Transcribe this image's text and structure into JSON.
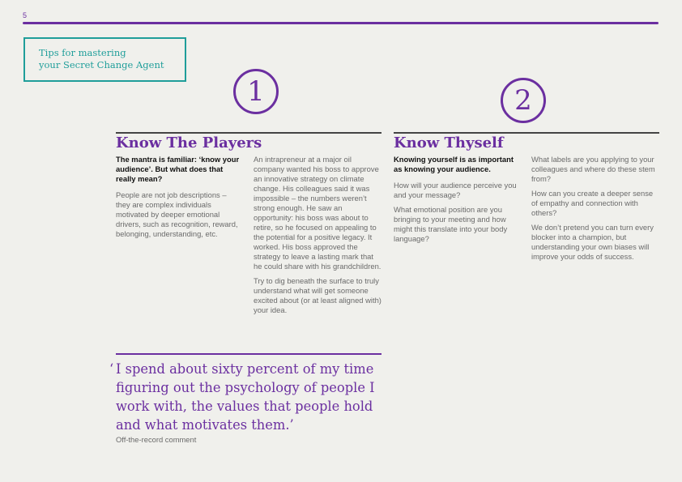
{
  "page_number": "5",
  "tips_box": {
    "line1": "Tips for mastering",
    "line2": "your Secret Change Agent"
  },
  "section1": {
    "number": "1",
    "title": "Know The Players",
    "lead": "The mantra is familiar: ‘know your audience’. But what does that really mean?",
    "col1_paragraphs": [
      "People are not job descriptions – they are complex individuals motivated by deeper emotional drivers, such as recognition, reward, belonging, understanding, etc."
    ],
    "col2_paragraphs": [
      "An intrapreneur at a major oil company wanted his boss to approve an innovative strategy on climate change. His colleagues said it was impossible – the numbers weren’t strong enough. He saw an opportunity: his boss was about to retire, so he focused on appealing to the potential for a positive legacy. It worked. His boss approved the strategy to leave a lasting mark that he could share with his grandchildren.",
      "Try to dig beneath the surface to truly understand what will get someone excited about (or at least aligned with) your idea."
    ]
  },
  "section2": {
    "number": "2",
    "title": "Know Thyself",
    "lead": "Knowing yourself is as important as knowing your audience.",
    "col3_paragraphs": [
      "How will your audience perceive you and your message?",
      "What emotional position are you bringing to your meeting and how might this translate into your body language?"
    ],
    "col4_paragraphs": [
      "What labels are you applying to your colleagues and where do these stem from?",
      "How can you create a deeper sense of empathy and connection with others?",
      "We don’t pretend you can turn every blocker into a champion, but understanding your own biases will improve your odds of success."
    ]
  },
  "quote": {
    "open_mark": "‘",
    "text": "I spend about sixty percent of my time figuring out the psychology of people I work with, the values that people hold and what motivates them.’",
    "attribution": "Off-the-record comment"
  },
  "colors": {
    "purple": "#6b2fa0",
    "teal": "#1f9e9a"
  }
}
